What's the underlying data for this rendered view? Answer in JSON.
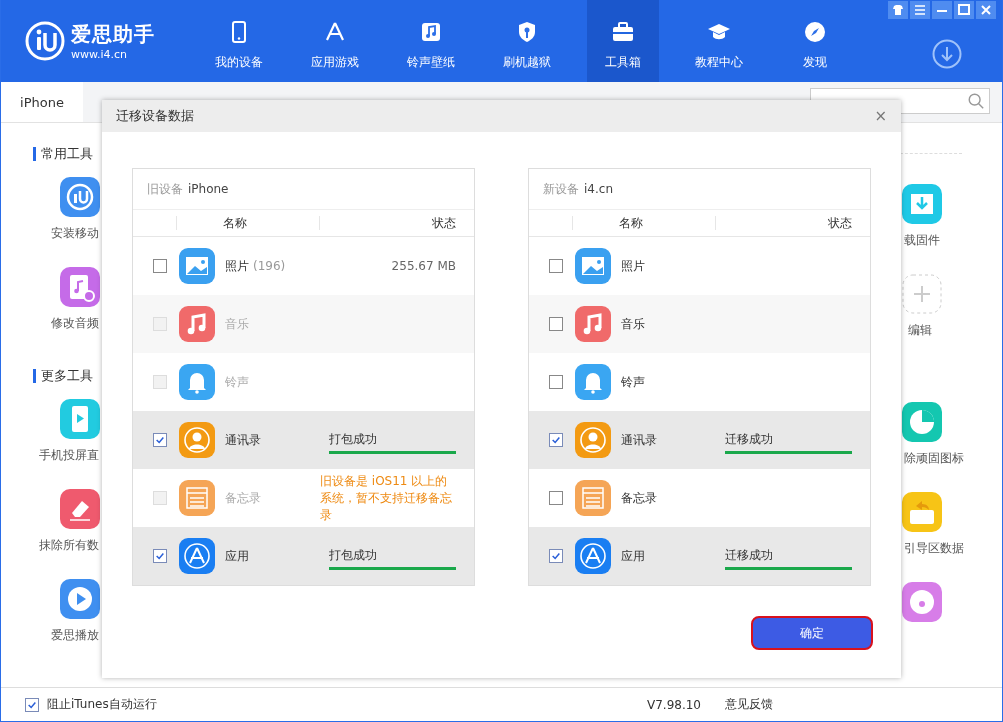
{
  "app": {
    "name": "爱思助手",
    "site": "www.i4.cn"
  },
  "window_controls": [
    {
      "kind": "skin"
    },
    {
      "kind": "menu"
    },
    {
      "kind": "minimize"
    },
    {
      "kind": "maximize"
    },
    {
      "kind": "close"
    }
  ],
  "nav": [
    {
      "label": "我的设备",
      "kind": "device",
      "selected": false
    },
    {
      "label": "应用游戏",
      "kind": "apps",
      "selected": false
    },
    {
      "label": "铃声壁纸",
      "kind": "music",
      "selected": false
    },
    {
      "label": "刷机越狱",
      "kind": "shield",
      "selected": false
    },
    {
      "label": "工具箱",
      "kind": "toolbox",
      "selected": true
    },
    {
      "label": "教程中心",
      "kind": "cap",
      "selected": false
    },
    {
      "label": "发现",
      "kind": "compass",
      "selected": false
    }
  ],
  "tabs": [
    {
      "label": "iPhone",
      "selected": true
    }
  ],
  "left_sections": [
    {
      "title": "常用工具",
      "tools": [
        {
          "label": "安装移动",
          "kind": "i4"
        },
        {
          "label": "修改音频",
          "kind": "audio"
        }
      ]
    },
    {
      "title": "更多工具",
      "tools": [
        {
          "label": "手机投屏直",
          "kind": "cast"
        },
        {
          "label": "抹除所有数",
          "kind": "erase"
        },
        {
          "label": "爱思播放",
          "kind": "player"
        }
      ]
    }
  ],
  "right_tools": [
    {
      "label": "载固件",
      "kind": "download"
    },
    {
      "label": "编辑",
      "kind": "add"
    },
    {
      "label": "除顽固图标",
      "kind": "clock"
    },
    {
      "label": "引导区数据",
      "kind": "disk"
    },
    {
      "kind": "bird"
    }
  ],
  "dialog": {
    "title": "迁移设备数据",
    "close": "×",
    "panels": [
      {
        "device_label": "旧设备",
        "device_name": "iPhone",
        "columns": [
          "名称",
          "状态"
        ],
        "rows": [
          {
            "kind": "photos",
            "name": "照片",
            "count": "(196)",
            "size": "255.67 MB",
            "checked": false,
            "disabled": false
          },
          {
            "kind": "music",
            "name": "音乐",
            "checked": false,
            "disabled": true
          },
          {
            "kind": "ringtone",
            "name": "铃声",
            "checked": false,
            "disabled": true
          },
          {
            "kind": "contacts",
            "name": "通讯录",
            "checked": true,
            "disabled": false,
            "status": "打包成功",
            "level": 1
          },
          {
            "kind": "notes",
            "name": "备忘录",
            "checked": false,
            "disabled": true,
            "note": "旧设备是 iOS11 以上的系统，暂不支持迁移备忘录"
          },
          {
            "kind": "appstore",
            "name": "应用",
            "checked": true,
            "disabled": false,
            "status": "打包成功",
            "level": 1
          }
        ]
      },
      {
        "device_label": "新设备",
        "device_name": "i4.cn",
        "columns": [
          "名称",
          "状态"
        ],
        "rows": [
          {
            "kind": "photos",
            "name": "照片",
            "checked": false,
            "disabled": false
          },
          {
            "kind": "music",
            "name": "音乐",
            "checked": false,
            "disabled": false
          },
          {
            "kind": "ringtone",
            "name": "铃声",
            "checked": false,
            "disabled": false
          },
          {
            "kind": "contacts",
            "name": "通讯录",
            "checked": true,
            "disabled": false,
            "status": "迁移成功",
            "level": 1
          },
          {
            "kind": "notes",
            "name": "备忘录",
            "checked": false,
            "disabled": false
          },
          {
            "kind": "appstore",
            "name": "应用",
            "checked": true,
            "disabled": false,
            "status": "迁移成功",
            "level": 1
          }
        ]
      }
    ],
    "confirm": "确定"
  },
  "footer": {
    "itunes_block": {
      "label": "阻止iTunes自动运行",
      "checked": true
    },
    "version": "V7.98.10",
    "feedback": "意见反馈"
  }
}
